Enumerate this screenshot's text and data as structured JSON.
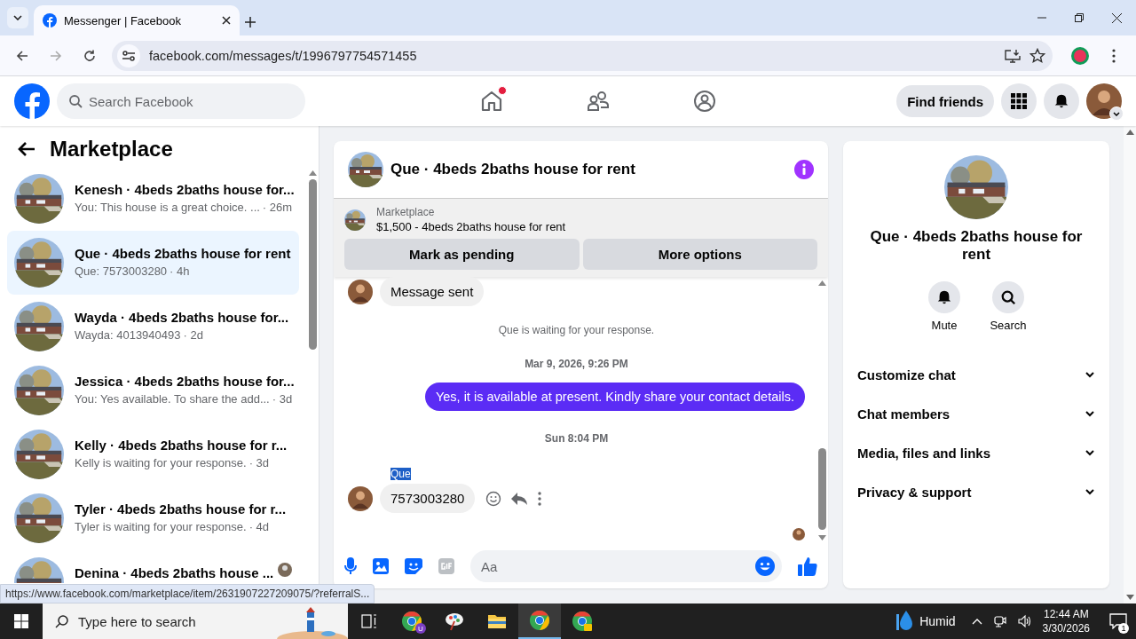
{
  "browser": {
    "tabs": [
      {
        "title": "Messenger | Facebook",
        "selected": true
      }
    ],
    "url": "facebook.com/messages/t/1996797754571455"
  },
  "header": {
    "search_placeholder": "Search Facebook",
    "nav": [
      {
        "kind": "home",
        "has_notification": true
      },
      {
        "kind": "friends"
      },
      {
        "kind": "groups"
      }
    ],
    "find_friends": "Find friends"
  },
  "sidebar": {
    "title": "Marketplace",
    "conversations": [
      {
        "name": "Kenesh · 4beds 2baths house for...",
        "preview": "You: This house is a great choice. ...",
        "time": "· 26m",
        "selected": false
      },
      {
        "name": "Que · 4beds 2baths house for rent",
        "preview": "Que: 7573003280",
        "time": "· 4h",
        "selected": true
      },
      {
        "name": "Wayda · 4beds 2baths house for...",
        "preview": "Wayda: 4013940493",
        "time": "· 2d",
        "selected": false
      },
      {
        "name": "Jessica · 4beds 2baths house for...",
        "preview": "You: Yes available. To share the add...",
        "time": "· 3d",
        "selected": false
      },
      {
        "name": "Kelly · 4beds 2baths house for r...",
        "preview": "Kelly is waiting for your response.",
        "time": "· 3d",
        "selected": false
      },
      {
        "name": "Tyler · 4beds 2baths house for r...",
        "preview": "Tyler is waiting for your response.",
        "time": "· 4d",
        "selected": false
      },
      {
        "name": "Denina · 4beds 2baths house ...",
        "selected": false,
        "seen": true
      }
    ]
  },
  "chat": {
    "title": "Que · 4beds 2baths house for rent",
    "listing": {
      "label": "Marketplace",
      "title": "$1,500 - 4beds 2baths house for rent"
    },
    "actions": [
      "Mark as pending",
      "More options"
    ],
    "messages": [
      {
        "kind": "incoming",
        "text": "Message sent"
      },
      {
        "kind": "notice",
        "text": "Que is waiting for your response."
      },
      {
        "kind": "timestamp",
        "text": "Mar 9, 2026, 9:26 PM"
      },
      {
        "kind": "outgoing",
        "text": "Yes, it is available at present. Kindly share your contact details."
      },
      {
        "kind": "timestamp",
        "text": "Sun 8:04 PM"
      },
      {
        "kind": "incoming",
        "sender": "Que",
        "sender_highlighted": true,
        "text": "7573003280",
        "hover_actions": true
      }
    ],
    "composer_placeholder": "Aa"
  },
  "details": {
    "title": "Que · 4beds 2baths house for rent",
    "actions": [
      {
        "kind": "mute",
        "label": "Mute"
      },
      {
        "kind": "search",
        "label": "Search"
      }
    ],
    "sections": [
      {
        "label": "Customize chat",
        "expanded": false
      },
      {
        "label": "Chat members",
        "expanded": false
      },
      {
        "label": "Media, files and links",
        "expanded": false
      },
      {
        "label": "Privacy & support",
        "expanded": false
      }
    ]
  },
  "status_url": "https://www.facebook.com/marketplace/item/2631907227209075/?referralS...",
  "taskbar": {
    "search_placeholder": "Type here to search",
    "apps": [
      {
        "kind": "chrome",
        "badge": "U",
        "selected": false
      },
      {
        "kind": "paint",
        "selected": false
      },
      {
        "kind": "folder",
        "selected": false
      },
      {
        "kind": "chrome",
        "selected": true
      },
      {
        "kind": "chrome-lock",
        "selected": false
      }
    ],
    "weather": "Humid",
    "time": "12:44 AM",
    "date": "3/30/2026",
    "notifications": "1"
  }
}
